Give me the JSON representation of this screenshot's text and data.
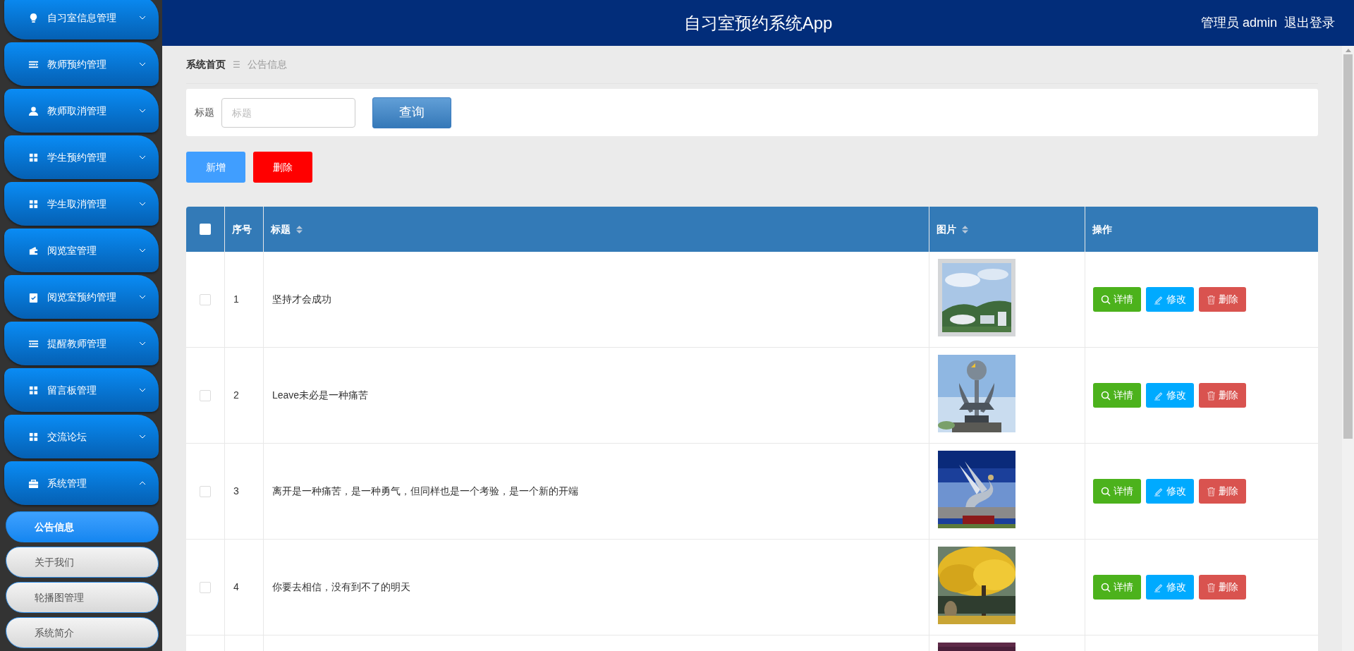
{
  "sidebar": {
    "items": [
      {
        "label": "自习室信息管理",
        "expanded": false
      },
      {
        "label": "教师预约管理",
        "expanded": false
      },
      {
        "label": "教师取消管理",
        "expanded": false
      },
      {
        "label": "学生预约管理",
        "expanded": false
      },
      {
        "label": "学生取消管理",
        "expanded": false
      },
      {
        "label": "阅览室管理",
        "expanded": false
      },
      {
        "label": "阅览室预约管理",
        "expanded": false
      },
      {
        "label": "提醒教师管理",
        "expanded": false
      },
      {
        "label": "留言板管理",
        "expanded": false
      },
      {
        "label": "交流论坛",
        "expanded": false
      },
      {
        "label": "系统管理",
        "expanded": true,
        "children": [
          {
            "label": "公告信息",
            "selected": true
          },
          {
            "label": "关于我们",
            "selected": false
          },
          {
            "label": "轮播图管理",
            "selected": false
          },
          {
            "label": "系统简介",
            "selected": false
          }
        ]
      }
    ]
  },
  "header": {
    "title": "自习室预约系统App",
    "user": "管理员 admin",
    "logout": "退出登录"
  },
  "breadcrumb": {
    "home": "系统首页",
    "separator": "☰",
    "current": "公告信息"
  },
  "search": {
    "label": "标题",
    "placeholder": "标题",
    "button": "查询"
  },
  "actions": {
    "add": "新增",
    "delete": "删除"
  },
  "table": {
    "select_all_checked": false,
    "columns": [
      {
        "label": "序号",
        "sortable": false
      },
      {
        "label": "标题",
        "sortable": true
      },
      {
        "label": "图片",
        "sortable": true
      },
      {
        "label": "操作",
        "sortable": false
      }
    ],
    "rows": [
      {
        "checked": false,
        "index": "1",
        "title": "坚持才会成功",
        "image": {
          "kind": "picture"
        },
        "buttons": [
          "详情",
          "修改",
          "删除"
        ]
      },
      {
        "checked": false,
        "index": "2",
        "title": "Leave未必是一种痛苦",
        "image": {
          "kind": "picture"
        },
        "buttons": [
          "详情",
          "修改",
          "删除"
        ]
      },
      {
        "checked": false,
        "index": "3",
        "title": "离开是一种痛苦，是一种勇气，但同样也是一个考验，是一个新的开端",
        "image": {
          "kind": "picture"
        },
        "buttons": [
          "详情",
          "修改",
          "删除"
        ]
      },
      {
        "checked": false,
        "index": "4",
        "title": "你要去相信，没有到不了的明天",
        "image": {
          "kind": "picture"
        },
        "buttons": [
          "详情",
          "修改",
          "删除"
        ]
      },
      {
        "image": {
          "kind": "picture"
        }
      }
    ]
  }
}
